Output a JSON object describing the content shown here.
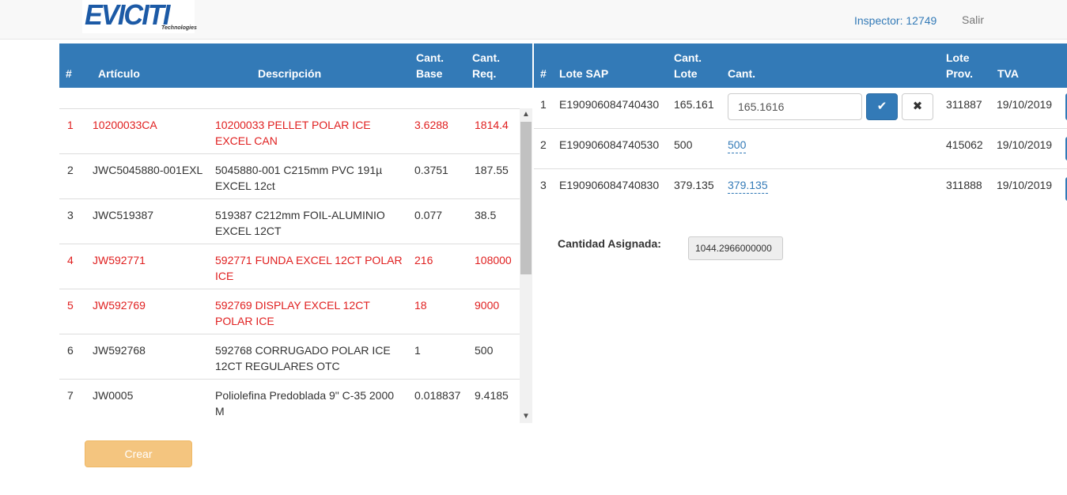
{
  "nav": {
    "logo_text": "EVICITI",
    "logo_sub": "Technologies",
    "inspector": "Inspector: 12749",
    "logout": "Salir"
  },
  "left_table": {
    "headers": {
      "num": "#",
      "articulo": "Artículo",
      "descripcion": "Descripción",
      "cant_base_1": "Cant.",
      "cant_base_2": "Base",
      "cant_req_1": "Cant.",
      "cant_req_2": "Req."
    },
    "rows": [
      {
        "num": "1",
        "articulo": "10200033CA",
        "desc1": "10200033 PELLET POLAR ICE",
        "desc2": "EXCEL CAN",
        "base": "3.6288",
        "req": "1814.4"
      },
      {
        "num": "2",
        "articulo": "JWC5045880-001EXL",
        "desc1": "5045880-001 C215mm PVC 191µ",
        "desc2": "EXCEL 12ct",
        "base": "0.3751",
        "req": "187.55"
      },
      {
        "num": "3",
        "articulo": "JWC519387",
        "desc1": "519387 C212mm FOIL-ALUMINIO",
        "desc2": "EXCEL 12CT",
        "base": "0.077",
        "req": "38.5"
      },
      {
        "num": "4",
        "articulo": "JW592771",
        "desc1": "592771 FUNDA EXCEL 12CT POLAR",
        "desc2": "ICE",
        "base": "216",
        "req": "108000"
      },
      {
        "num": "5",
        "articulo": "JW592769",
        "desc1": "592769 DISPLAY EXCEL 12CT",
        "desc2": "POLAR ICE",
        "base": "18",
        "req": "9000"
      },
      {
        "num": "6",
        "articulo": "JW592768",
        "desc1": "592768 CORRUGADO POLAR ICE",
        "desc2": "12CT REGULARES OTC",
        "base": "1",
        "req": "500"
      },
      {
        "num": "7",
        "articulo": "JW0005",
        "desc1": "Poliolefina Predoblada 9\" C-35 2000",
        "desc2": "M",
        "base": "0.018837",
        "req": "9.4185"
      }
    ],
    "crear_label": "Crear"
  },
  "right_table": {
    "headers": {
      "num": "#",
      "lote_sap": "Lote SAP",
      "cant_lote_1": "Cant.",
      "cant_lote_2": "Lote",
      "cant": "Cant.",
      "lote_prov_1": "Lote",
      "lote_prov_2": "Prov.",
      "tva": "TVA"
    },
    "rows": [
      {
        "num": "1",
        "lote_sap": "E190906084740430",
        "cant_lote": "165.161",
        "cant": "165.1616",
        "lote_prov": "311887",
        "tva": "19/10/2019"
      },
      {
        "num": "2",
        "lote_sap": "E190906084740530",
        "cant_lote": "500",
        "cant": "500",
        "lote_prov": "415062",
        "tva": "19/10/2019"
      },
      {
        "num": "3",
        "lote_sap": "E190906084740830",
        "cant_lote": "379.135",
        "cant": "379.135",
        "lote_prov": "311888",
        "tva": "19/10/2019"
      }
    ],
    "asignada_label": "Cantidad Asignada:",
    "asignada_value": "1044.2966000000"
  },
  "icons": {
    "confirm": "check-icon",
    "cancel": "close-icon",
    "scroll_up": "chevron-up-icon",
    "scroll_down": "chevron-down-icon"
  },
  "colors": {
    "header_bg": "#337ab7",
    "alert_text": "#e02020",
    "crear_bg": "#f4c57f"
  }
}
